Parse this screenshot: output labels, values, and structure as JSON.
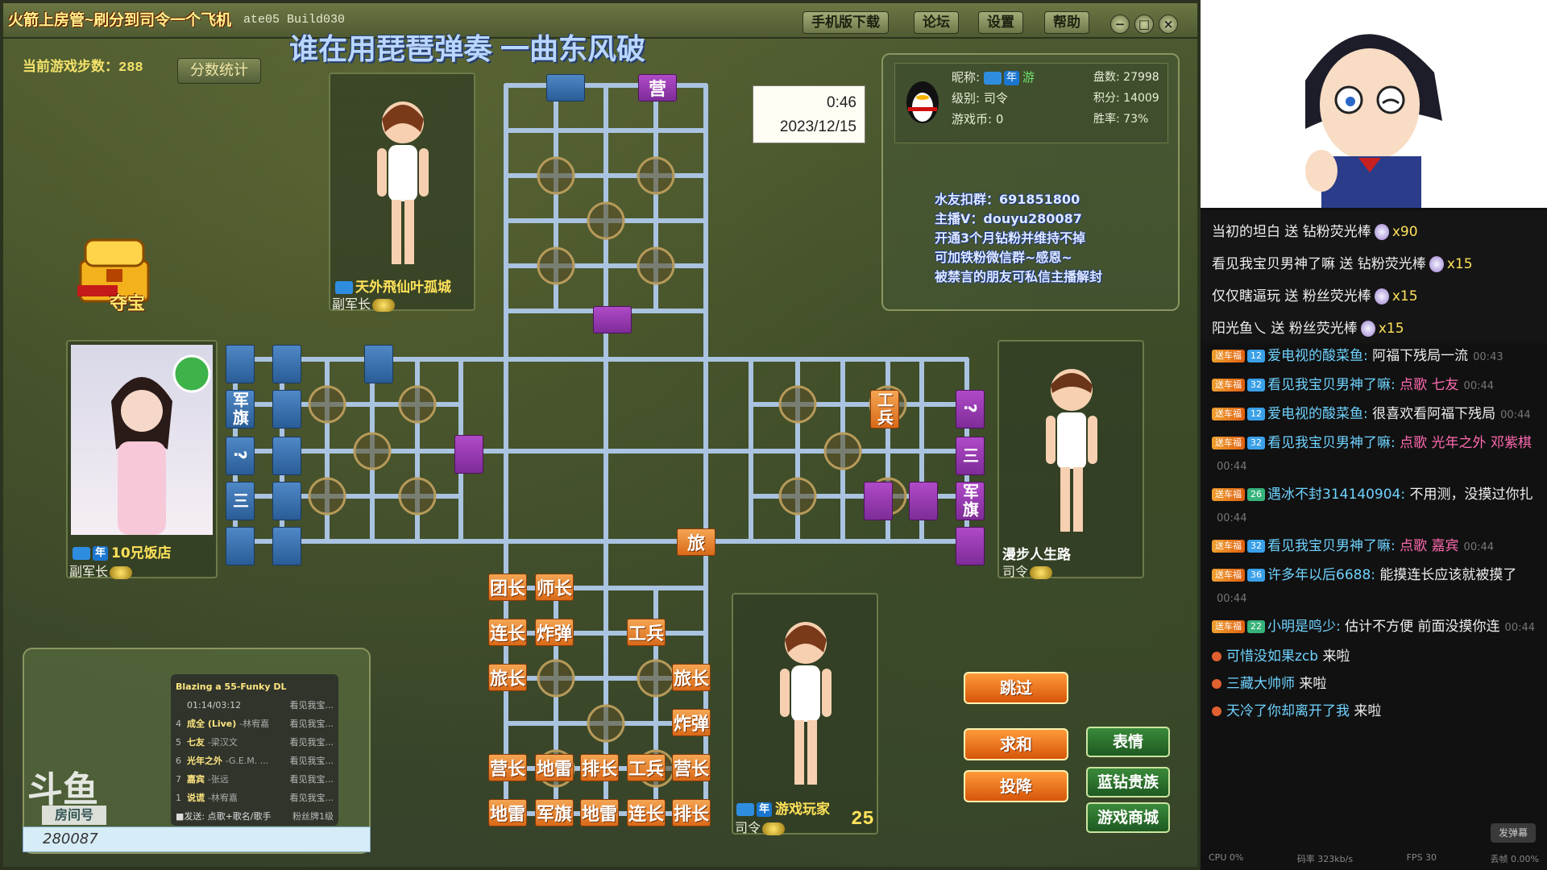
{
  "window": {
    "title": "火箭上房管~刷分到司令一个飞机",
    "build": "ate05 Build030",
    "song_banner": "谁在用琵琶弹奏 一曲东风破",
    "buttons": [
      "手机版下载",
      "论坛",
      "设置",
      "帮助"
    ],
    "controls": [
      "−",
      "□",
      "×"
    ]
  },
  "game": {
    "step_label": "当前游戏步数：",
    "step_count": "288",
    "score_stats": "分数统计",
    "treasure": "夺宝",
    "timer": "0:46",
    "date": "2023/12/15",
    "bottom_steps": "25"
  },
  "info": {
    "nickname_label": "昵称:",
    "nickname_badges": [
      "年",
      "游"
    ],
    "level": "级别: 司令",
    "coins": "游戏币: 0",
    "games": "盘数: 27998",
    "points": "积分: 14009",
    "win_rate": "胜率: 73%",
    "ads": [
      "水友扣群：691851800",
      "主播V：douyu280087",
      "开通3个月钻粉并维持不掉",
      "可加铁粉微信群~感恩~",
      "被禁言的朋友可私信主播解封"
    ]
  },
  "players": {
    "top": {
      "name": "天外飛仙叶孤城",
      "rank": "副军长"
    },
    "left": {
      "name": "10兄饭店",
      "rank": "副军长",
      "year": "年"
    },
    "right": {
      "name": "漫步人生路",
      "rank": "司令"
    },
    "bottom": {
      "name": "游戏玩家",
      "rank": "司令",
      "year": "年"
    }
  },
  "pieces": {
    "top_camp": "营",
    "left_vert": [
      "军旗",
      "?",
      "三"
    ],
    "right_vert": [
      "工兵",
      "?",
      "三",
      "军旗"
    ],
    "mid_brigade": "旅",
    "bottom": [
      [
        "团长",
        "师长"
      ],
      [
        "连长",
        "炸弹",
        "工兵"
      ],
      [
        "旅长",
        "旅长"
      ],
      [
        "炸弹"
      ],
      [
        "营长",
        "地雷",
        "排长",
        "工兵",
        "营长"
      ],
      [
        "地雷",
        "军旗",
        "地雷",
        "连长",
        "排长"
      ]
    ]
  },
  "actions": {
    "skip": "跳过",
    "draw": "求和",
    "surrender": "投降",
    "emote": "表情",
    "blue_diamond": "蓝钻贵族",
    "shop": "游戏商城"
  },
  "music": {
    "now_playing": "Blazing a 55-Funky DL",
    "time": "01:14/03:12",
    "requested_by": "看见我宝...",
    "queue": [
      {
        "num": "4",
        "song": "成全 (Live)",
        "artist": "-林宥嘉",
        "req": "看见我宝..."
      },
      {
        "num": "5",
        "song": "七友",
        "artist": "-梁汉文",
        "req": "看见我宝..."
      },
      {
        "num": "6",
        "song": "光年之外",
        "artist": "-G.E.M. ...",
        "req": "看见我宝..."
      },
      {
        "num": "7",
        "song": "嘉宾",
        "artist": "-张远",
        "req": "看见我宝..."
      },
      {
        "num": "1",
        "song": "说谎",
        "artist": "-林宥嘉",
        "req": "看见我宝..."
      }
    ],
    "footer_left": "■发送: 点歌+歌名/歌手",
    "footer_right": "粉丝牌1级",
    "logo": "斗鱼",
    "room_label": "房间号",
    "room_number": "280087"
  },
  "gifts": [
    {
      "user": "当初的坦白",
      "action": "送 钻粉荧光棒",
      "count": "x90"
    },
    {
      "user": "看见我宝贝男神了嘛",
      "action": "送 钻粉荧光棒",
      "count": "x15"
    },
    {
      "user": "仅仅瞎逼玩",
      "action": "送 粉丝荧光棒",
      "count": "x15"
    },
    {
      "user": "阳光鱼乀",
      "action": "送 粉丝荧光棒",
      "count": "x15"
    }
  ],
  "chat": [
    {
      "fan": "送车福",
      "lvl": "12",
      "user": "爱电视的酸菜鱼:",
      "text": "阿福下残局一流",
      "ts": "00:43"
    },
    {
      "fan": "送车福",
      "lvl": "32",
      "user": "看见我宝贝男神了嘛:",
      "text": "点歌 七友",
      "ts": "00:44",
      "song": true
    },
    {
      "fan": "送车福",
      "lvl": "12",
      "user": "爱电视的酸菜鱼:",
      "text": "很喜欢看阿福下残局",
      "ts": "00:44"
    },
    {
      "fan": "送车福",
      "lvl": "32",
      "user": "看见我宝贝男神了嘛:",
      "text": "点歌 光年之外 邓紫棋",
      "ts": "00:44",
      "song": true
    },
    {
      "fan": "送车福",
      "lvl": "26",
      "user": "遇冰不封314140904:",
      "text": "不用测，没摸过你扎",
      "ts": "00:44"
    },
    {
      "fan": "送车福",
      "lvl": "32",
      "user": "看见我宝贝男神了嘛:",
      "text": "点歌 嘉宾",
      "ts": "00:44",
      "song": true
    },
    {
      "fan": "送车福",
      "lvl": "36",
      "user": "许多年以后6688:",
      "text": "能摸连长应该就被摸了",
      "ts": "00:44"
    },
    {
      "fan": "送车福",
      "lvl": "22",
      "user": "小明是鸣少:",
      "text": "估计不方便 前面没摸你连",
      "ts": "00:44"
    }
  ],
  "entries": [
    {
      "user": "可惜没如果zcb",
      "text": "来啦"
    },
    {
      "user": "三藏大帅师",
      "text": "来啦"
    },
    {
      "user": "天冷了你却离开了我",
      "text": "来啦"
    }
  ],
  "status": {
    "cpu": "CPU 0%",
    "bitrate": "码率 323kb/s",
    "fps": "FPS 30",
    "drop": "丢帧 0.00%",
    "danmu": "发弹幕"
  }
}
